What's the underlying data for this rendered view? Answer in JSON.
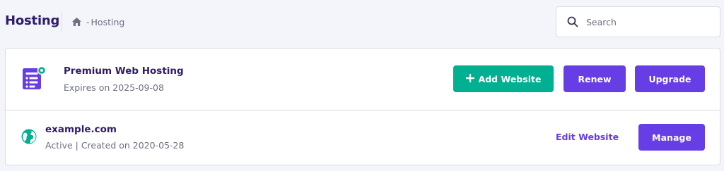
{
  "header": {
    "title": "Hosting",
    "breadcrumb_sep": "- ",
    "breadcrumb_current": "Hosting"
  },
  "search": {
    "placeholder": "Search"
  },
  "plan": {
    "icon": "hosting-plan-icon",
    "name": "Premium Web Hosting",
    "expiry": "Expires on 2025-09-08",
    "buttons": {
      "add_website": "Add Website",
      "renew": "Renew",
      "upgrade": "Upgrade"
    }
  },
  "website": {
    "icon": "globe-icon",
    "domain": "example.com",
    "status": "Active | Created on 2020-05-28",
    "edit_label": "Edit Website",
    "manage_label": "Manage"
  },
  "colors": {
    "brand_purple": "#673de6",
    "green": "#00b090",
    "title_text": "#2f1c6a",
    "muted_text": "#6d7081",
    "background": "#f4f4fb"
  }
}
